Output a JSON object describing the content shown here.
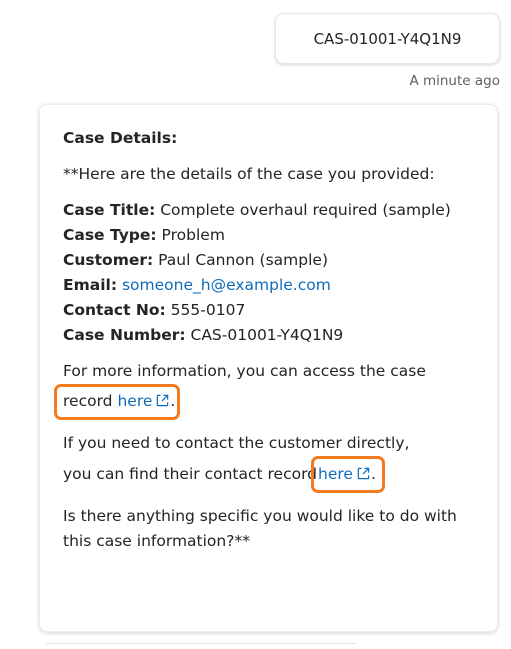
{
  "user_message": {
    "text": "CAS-01001-Y4Q1N9",
    "timestamp": "A minute ago"
  },
  "bot_message": {
    "heading": "Case Details:",
    "intro": "**Here are the details of the case you provided:",
    "fields": [
      {
        "label": "Case Title:",
        "value": " Complete overhaul required (sample)"
      },
      {
        "label": "Case Type:",
        "value": " Problem"
      },
      {
        "label": "Customer:",
        "value": " Paul Cannon (sample)"
      },
      {
        "label": "Email:",
        "value": " ",
        "link": "someone_h@example.com"
      },
      {
        "label": "Contact No:",
        "value": " 555-0107"
      },
      {
        "label": "Case Number:",
        "value": " CAS-01001-Y4Q1N9"
      }
    ],
    "more_info": {
      "line1": "For more information, you can access the case",
      "line2_prefix": "record",
      "link": "here",
      "suffix": "."
    },
    "contact": {
      "line1": "If you need to contact the customer directly,",
      "line2_prefix": "you can find their contact record",
      "link": "here",
      "suffix": "."
    },
    "closing": "Is there anything specific you would like to do with this case information?**"
  },
  "colors": {
    "link": "#0f6cbd",
    "highlight": "#f47a20",
    "text": "#242424",
    "muted": "#616161"
  },
  "icons": {
    "external_link": "open-in-new-window-icon"
  }
}
